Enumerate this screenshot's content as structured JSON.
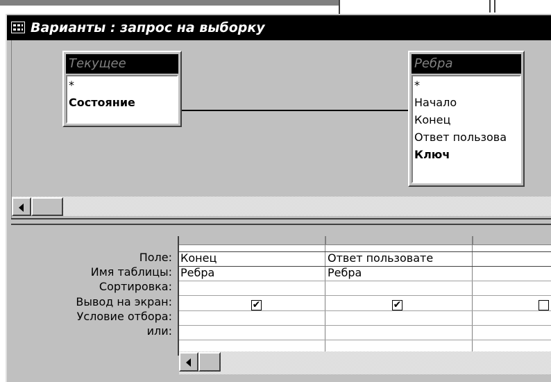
{
  "window": {
    "title": "Варианты : запрос на выборку"
  },
  "tables": [
    {
      "name": "Текущее",
      "fields": [
        {
          "label": "*",
          "key": false
        },
        {
          "label": "Состояние",
          "key": true
        }
      ]
    },
    {
      "name": "Ребра",
      "fields": [
        {
          "label": "*",
          "key": false
        },
        {
          "label": "Начало",
          "key": false
        },
        {
          "label": "Конец",
          "key": false
        },
        {
          "label": "Ответ пользова",
          "key": false
        },
        {
          "label": "Ключ",
          "key": true
        }
      ]
    }
  ],
  "grid": {
    "row_labels": [
      "Поле:",
      "Имя таблицы:",
      "Сортировка:",
      "Вывод на экран:",
      "Условие отбора:",
      "или:"
    ],
    "columns": [
      {
        "field": "Конец",
        "table": "Ребра",
        "sort": "",
        "show": true,
        "criteria": "",
        "or": ""
      },
      {
        "field": "Ответ пользовате",
        "table": "Ребра",
        "sort": "",
        "show": true,
        "criteria": "",
        "or": ""
      },
      {
        "field": "",
        "table": "",
        "sort": "",
        "show": false,
        "criteria": "",
        "or": ""
      }
    ]
  },
  "icons": {
    "title": "query-icon",
    "scroll_left": "scroll-left-arrow-icon",
    "check": "checkmark-icon"
  },
  "colors": {
    "titlebar": "#000000",
    "face": "#c0c0c0"
  }
}
